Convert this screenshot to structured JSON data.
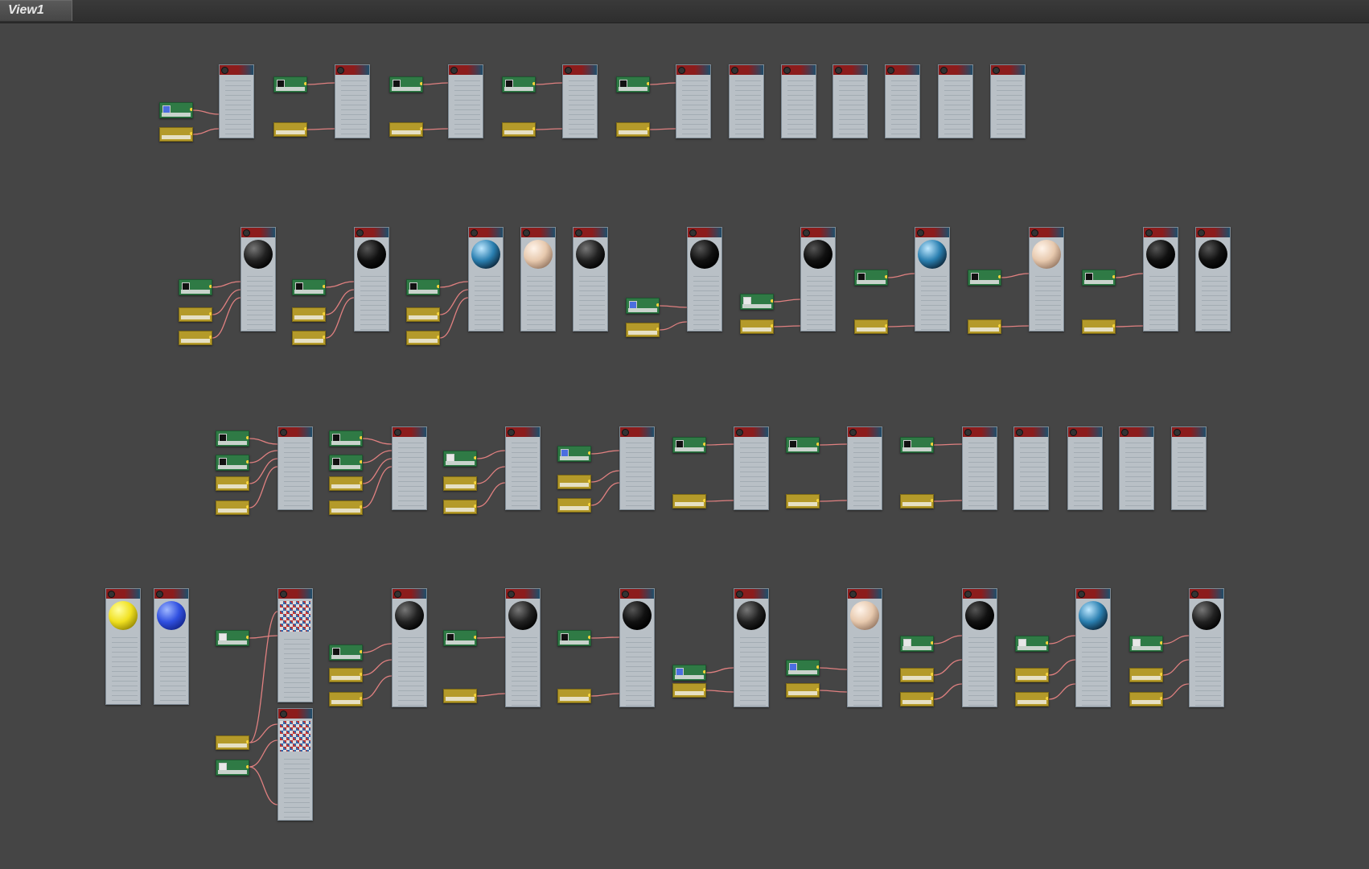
{
  "tab": {
    "title": "View1"
  },
  "colors": {
    "canvas": "#454545",
    "material_header_red": "#8c1c1c",
    "material_header_blue": "#1f4e6b",
    "material_body": "#b9c0c6",
    "map_node": "#2f7a45",
    "controller_node": "#b49a2a",
    "wire": "#e08080"
  }
}
